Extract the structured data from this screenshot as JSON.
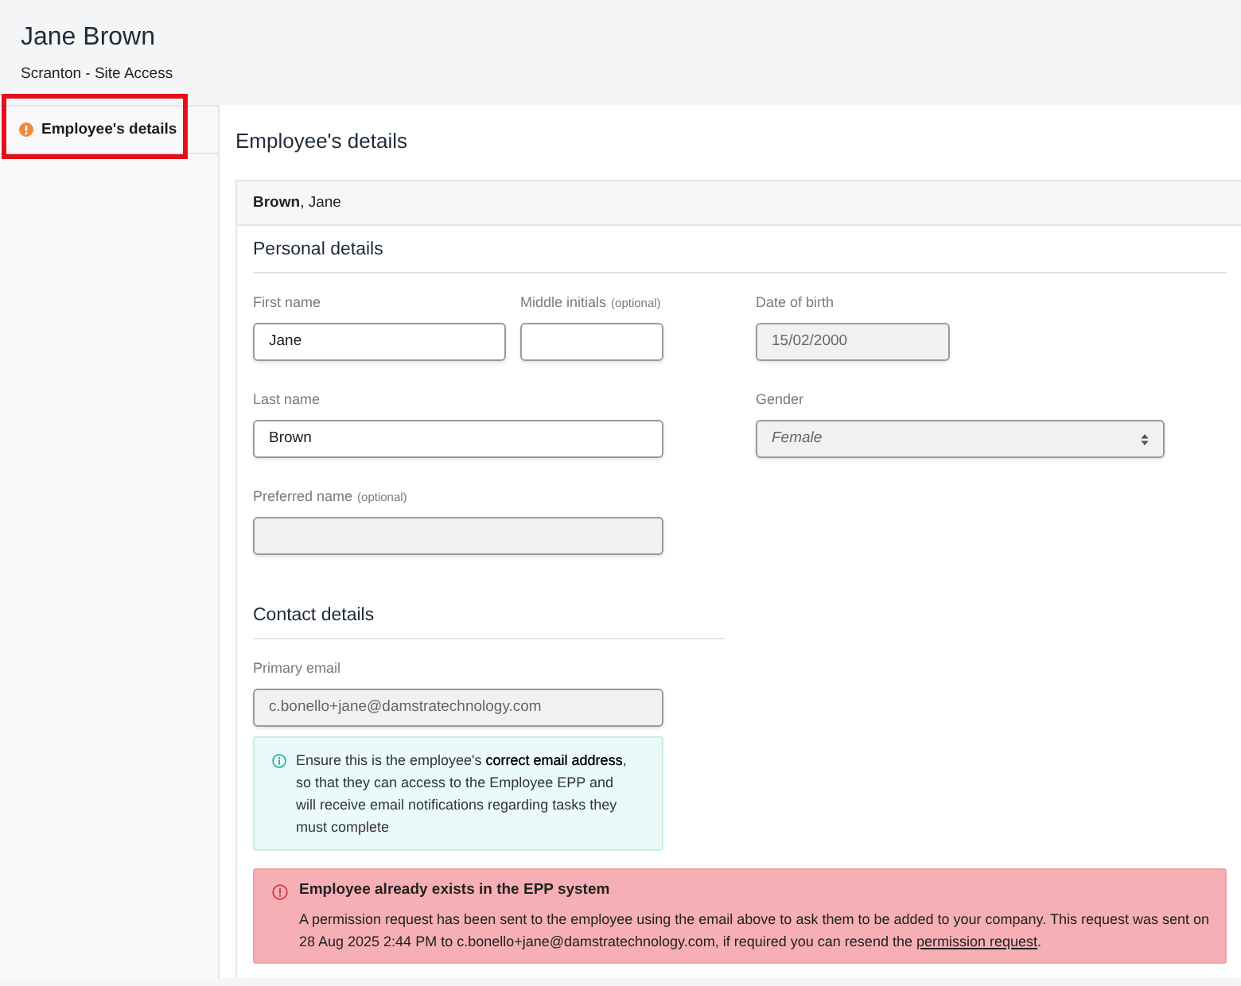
{
  "header": {
    "title": "Jane Brown",
    "subtitle": "Scranton - Site Access"
  },
  "sidebar": {
    "items": [
      {
        "label": "Employee's details",
        "selected": true,
        "warning": true,
        "annotated": true
      }
    ]
  },
  "main": {
    "heading": "Employee's details"
  },
  "card": {
    "header": "**Brown**, Jane",
    "sections": [
      {
        "title": "Personal details",
        "rows": [
          {
            "fields": [
              {
                "kind": "text",
                "label": "First name",
                "value": "Jane",
                "disabled": false
              },
              {
                "kind": "text",
                "label": "Middle initials",
                "note": "(optional)",
                "disabled": false
              },
              {
                "kind": "date",
                "label": "Date of birth",
                "value": "15/02/2000",
                "disabled": true
              }
            ]
          },
          {
            "fields": [
              {
                "kind": "text",
                "label": "Last name",
                "value": "Brown",
                "disabled": false
              },
              {
                "kind": "select",
                "label": "Gender",
                "value": "Female",
                "disabled": true
              }
            ]
          },
          {
            "fields": [
              {
                "kind": "text",
                "label": "Preferred name",
                "note": "(optional)",
                "disabled": true
              }
            ]
          }
        ]
      },
      {
        "title": "Contact details",
        "rows": [
          {
            "fields": [
              {
                "kind": "text",
                "label": "Primary email",
                "value": "c.bonello+jane@damstratechnology.com",
                "disabled": true
              }
            ]
          }
        ],
        "info": {
          "text": "Ensure this is the employee's **correct email address**, so that they can access to the Employee EPP and will receive email notifications regarding tasks they must complete"
        }
      }
    ],
    "alert": {
      "title": "Employee already exists in the EPP system",
      "text": "A permission request has been sent to the employee using the email above to ask them to be added to your company. This request was sent on 28 Aug 2025 2:44 PM to c.bonello+jane@damstratechnology.com, if required you can resend the",
      "link": "permission request",
      "end": "."
    }
  }
}
